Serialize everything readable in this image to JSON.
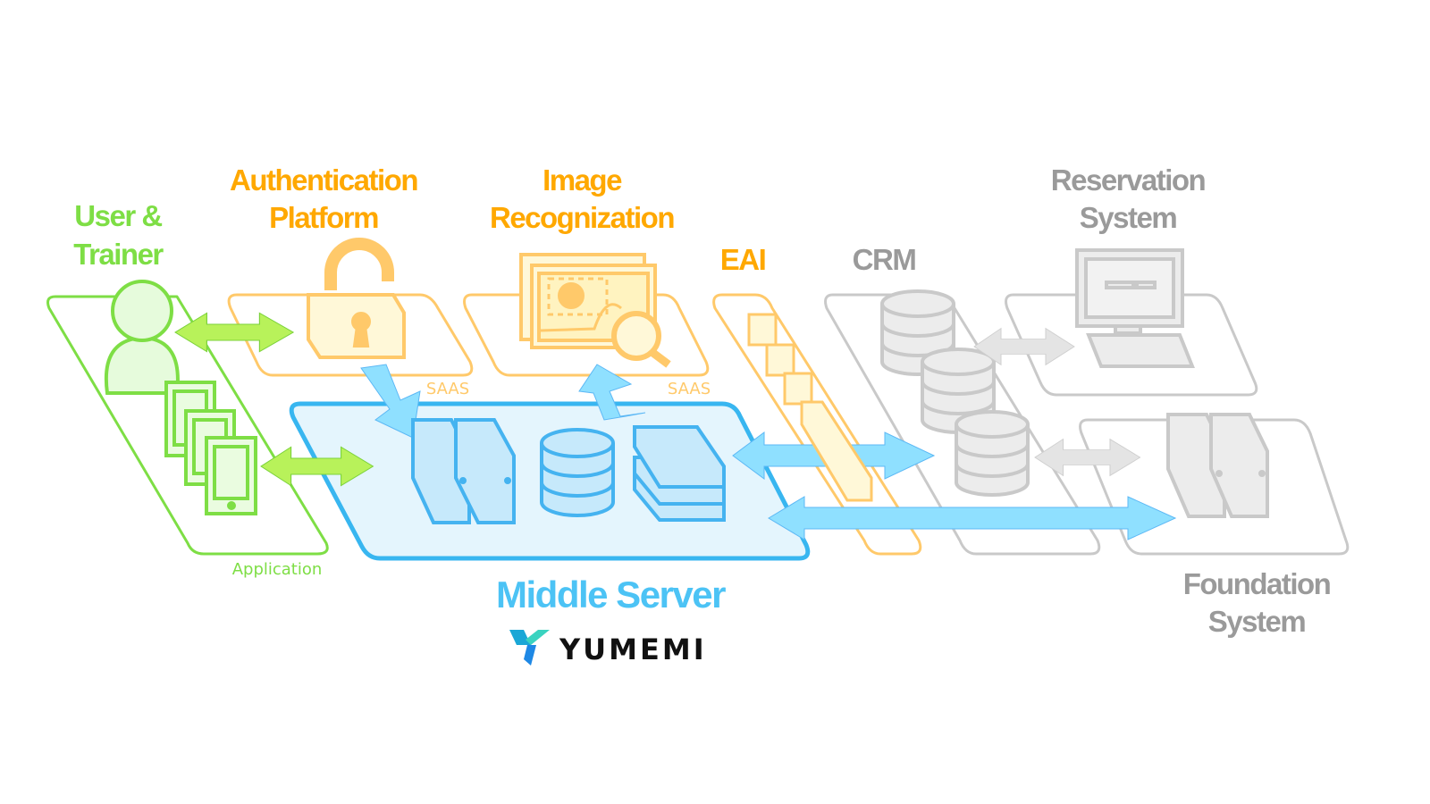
{
  "labels": {
    "user_line1": "User &",
    "user_line2": "Trainer",
    "auth_line1": "Authentication",
    "auth_line2": "Platform",
    "image_line1": "Image",
    "image_line2": "Recognization",
    "eai": "EAI",
    "crm": "CRM",
    "reservation_line1": "Reservation",
    "reservation_line2": "System",
    "foundation_line1": "Foundation",
    "foundation_line2": "System",
    "middle_server": "Middle Server",
    "application": "Application",
    "saas_auth": "SAAS",
    "saas_image": "SAAS"
  },
  "logo": {
    "text": "YUMEMI"
  },
  "colors": {
    "green": "#7ede45",
    "orange": "#ffa800",
    "orange_line": "#ffc96a",
    "blue": "#38b6f0",
    "blue_arrow": "#8fe0ff",
    "gray": "#c9c9c9",
    "gray_text": "#9a9a9a"
  },
  "icons": [
    "user-icon",
    "tablet-icon",
    "padlock-icon",
    "image-search-icon",
    "server-icon",
    "database-icon",
    "stacked-storage-icon",
    "eai-blocks-icon",
    "computer-icon",
    "double-arrow-icon"
  ]
}
